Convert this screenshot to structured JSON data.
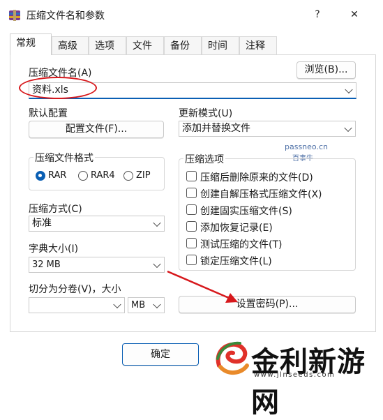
{
  "window": {
    "title": "压缩文件名和参数",
    "help": "?",
    "close": "✕"
  },
  "tabs": [
    "常规",
    "高级",
    "选项",
    "文件",
    "备份",
    "时间",
    "注释"
  ],
  "archive_name": {
    "label": "压缩文件名(A)",
    "value": "资料.xls",
    "browse": "浏览(B)..."
  },
  "profiles": {
    "label": "默认配置",
    "button": "配置文件(F)..."
  },
  "update_mode": {
    "label": "更新模式(U)",
    "value": "添加并替换文件"
  },
  "watermark": {
    "domain": "passneo.cn",
    "name": "百事牛"
  },
  "archive_format": {
    "label": "压缩文件格式",
    "options": [
      "RAR",
      "RAR4",
      "ZIP"
    ],
    "selected": "RAR"
  },
  "compression_options": {
    "label": "压缩选项",
    "items": [
      "压缩后删除原来的文件(D)",
      "创建自解压格式压缩文件(X)",
      "创建固实压缩文件(S)",
      "添加恢复记录(E)",
      "测试压缩的文件(T)",
      "锁定压缩文件(L)"
    ]
  },
  "method": {
    "label": "压缩方式(C)",
    "value": "标准"
  },
  "dictionary": {
    "label": "字典大小(I)",
    "value": "32 MB"
  },
  "split": {
    "label": "切分为分卷(V)，大小",
    "value": "",
    "unit": "MB"
  },
  "set_password": "设置密码(P)...",
  "ok_button": "确定",
  "brand": {
    "name": "金利新游网",
    "url": "www.jlnseeds.com"
  },
  "colors": {
    "accent": "#0a5fb4",
    "annotation": "#d7181c",
    "brand": "#111111"
  }
}
